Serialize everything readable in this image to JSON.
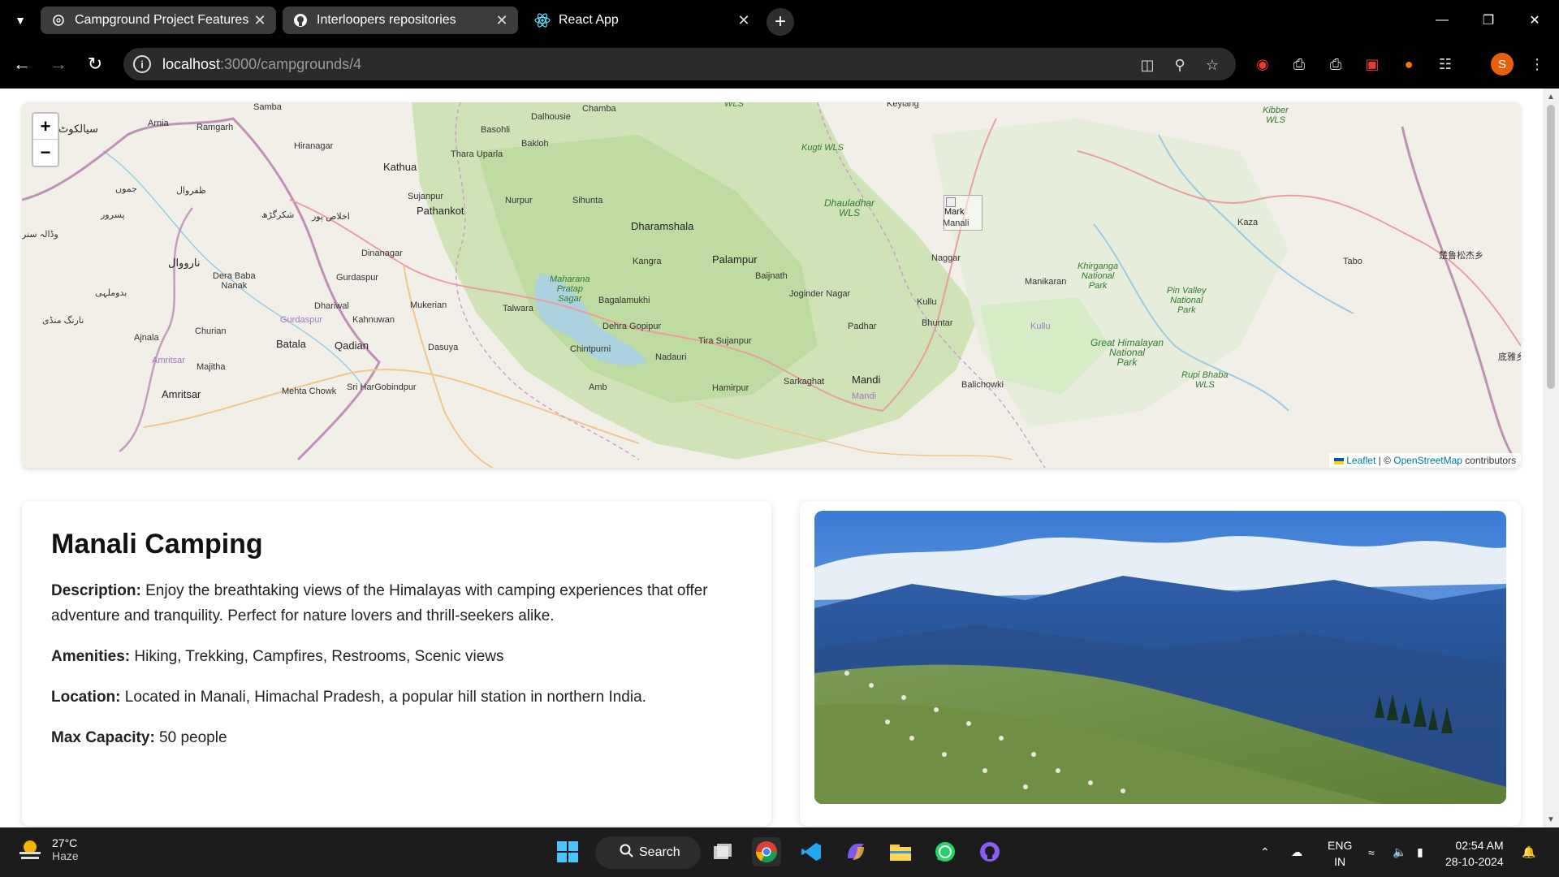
{
  "browser": {
    "tabs": [
      {
        "title": "Campground Project Features",
        "icon": "openai-icon",
        "active": false
      },
      {
        "title": "Interloopers repositories",
        "icon": "github-icon",
        "active": false
      },
      {
        "title": "React App",
        "icon": "react-icon",
        "active": true
      }
    ],
    "url_host": "localhost",
    "url_path": ":3000/campgrounds/4",
    "profile_initial": "S"
  },
  "map": {
    "labels": {
      "samba": "Samba",
      "arnia": "Arnia",
      "ramgarh": "Ramgarh",
      "sialkot": "سیالکوٹ",
      "hiranagar": "Hiranagar",
      "kathua": "Kathua",
      "basohli": "Basohli",
      "dalhousie": "Dalhousie",
      "chamba": "Chamba",
      "bakloh": "Bakloh",
      "thara_uparla": "Thara Uparla",
      "keylang": "Keylang",
      "kibber": "Kibber\nWLS",
      "kugti": "Kugti WLS",
      "wls_top": "WLS",
      "jammu": "جموں",
      "zafarwal": "ظفروال",
      "pasrur": "پسرور",
      "shakargarh": "شکرگڑھ",
      "ikhlaspur": "اخلاص پور",
      "sujanpur": "Sujanpur",
      "pathankot": "Pathankot",
      "nurpur": "Nurpur",
      "sihunta": "Sihunta",
      "dhauladhar": "Dhauladhar\nWLS",
      "dharamshala": "Dharamshala",
      "kaza": "Kaza",
      "wazirabad": "وڈالہ سنر",
      "dinanagar": "Dinanagar",
      "narowal": "نارووال",
      "kangra": "Kangra",
      "palampur": "Palampur",
      "naggar": "Naggar",
      "khirganga": "Khirganga\nNational\nPark",
      "tabo": "Tabo",
      "chinese": "楚鲁松杰乡",
      "dera_baba": "Dera Baba\nNanak",
      "gurdaspur": "Gurdaspur",
      "maharana": "Maharana\nPratap\nSagar",
      "baijnath": "Baijnath",
      "manikaran": "Manikaran",
      "pin_valley": "Pin Valley\nNational\nPark",
      "joginder": "Joginder Nagar",
      "badomalhi": "بدوملہی",
      "dhariwal": "Dhariwal",
      "mukerian": "Mukerian",
      "talwara": "Talwara",
      "bagalamukhi": "Bagalamukhi",
      "kullu": "Kullu",
      "narang": "نارنگ منڈی",
      "gurdaspur2": "Gurdaspur",
      "kahnuwan": "Kahnuwan",
      "dehra": "Dehra Gopipur",
      "padhar": "Padhar",
      "bhuntar": "Bhuntar",
      "kullu2": "Kullu",
      "churian": "Churian",
      "ajnala": "Ajnala",
      "batala": "Batala",
      "qadian": "Qadian",
      "dasuya": "Dasuya",
      "chintpurni": "Chintpurni",
      "tira": "Tira Sujanpur",
      "nadauri": "Nadauri",
      "great_himalayan": "Great Himalayan\nNational\nPark",
      "amritsar_small": "Amritsar",
      "majitha": "Majitha",
      "rupi_bhaba": "Rupi Bhaba\nWLS",
      "ghanpur": "底雅乡",
      "mandi": "Mandi",
      "amritsar": "Amritsar",
      "mehta": "Mehta Chowk",
      "sri_hargobindpur": "Sri HarGobindpur",
      "amb": "Amb",
      "hamirpur": "Hamirpur",
      "sarkaghat": "Sarkaghat",
      "balichowki": "Balichowki",
      "mandi2": "Mandi",
      "manali": "Manali"
    },
    "marker_alt": "Mark",
    "attribution_leaflet": "Leaflet",
    "attribution_sep": " | © ",
    "attribution_osm": "OpenStreetMap",
    "attribution_tail": " contributors",
    "zoom_in": "+",
    "zoom_out": "−"
  },
  "campground": {
    "name": "Manali Camping",
    "description_label": "Description:",
    "description": " Enjoy the breathtaking views of the Himalayas with camping experiences that offer adventure and tranquility. Perfect for nature lovers and thrill-seekers alike.",
    "amenities_label": "Amenities:",
    "amenities": " Hiking, Trekking, Campfires, Restrooms, Scenic views",
    "location_label": "Location:",
    "location": " Located in Manali, Himachal Pradesh, a popular hill station in northern India.",
    "capacity_label": "Max Capacity:",
    "capacity": " 50 people"
  },
  "taskbar": {
    "temperature": "27°C",
    "weather": "Haze",
    "search_label": "Search",
    "language": "ENG",
    "region": "IN",
    "time": "02:54 AM",
    "date": "28-10-2024"
  },
  "colors": {
    "chrome_bg": "#000000",
    "tab_inactive": "#3c3c3c",
    "omnibox": "#2b2b2b",
    "taskbar": "#1c1c1c",
    "link": "#0078a8",
    "profile": "#e8600e"
  }
}
